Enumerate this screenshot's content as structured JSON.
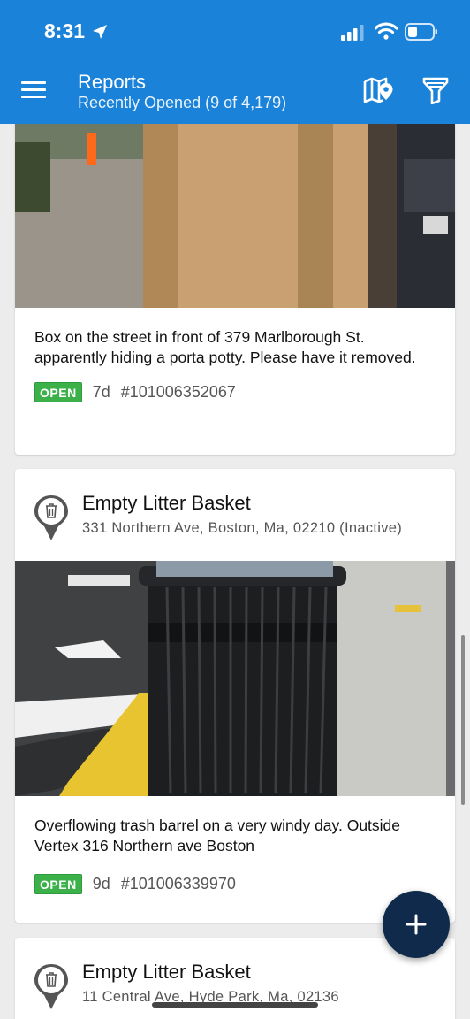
{
  "status_bar": {
    "time": "8:31"
  },
  "header": {
    "title": "Reports",
    "subtitle": "Recently Opened (9 of 4,179)"
  },
  "icons": [
    "location-arrow-icon",
    "signal-icon",
    "wifi-icon",
    "battery-icon",
    "menu-icon",
    "map-pin-icon",
    "filter-icon",
    "trash-icon",
    "plus-icon"
  ],
  "colors": {
    "header": "#1a82d8",
    "open_badge": "#3cb14a",
    "fab": "#0f2a4a"
  },
  "reports": [
    {
      "description": "Box on the street in front of 379 Marlborough St. apparently hiding a porta potty. Please have it removed.",
      "status": "OPEN",
      "age": "7d",
      "id": "#101006352067"
    },
    {
      "service": "Empty Litter Basket",
      "address": "331 Northern Ave, Boston, Ma, 02210 (Inactive)",
      "description": "Overflowing trash barrel on a very windy day. Outside Vertex 316 Northern ave Boston",
      "status": "OPEN",
      "age": "9d",
      "id": "#101006339970"
    },
    {
      "service": "Empty Litter Basket",
      "address": "11 Central Ave, Hyde Park, Ma, 02136"
    }
  ]
}
